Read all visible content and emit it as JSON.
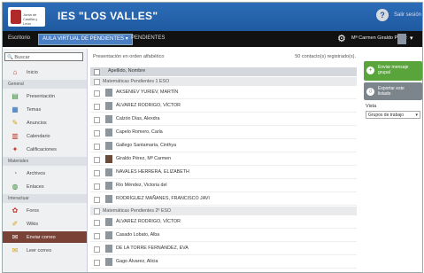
{
  "header": {
    "logo_text": [
      "Junta de",
      "Castilla y León"
    ],
    "title": "IES \"LOS VALLES\"",
    "help_label": "?",
    "login_label": "Salir sesión"
  },
  "navbar": {
    "breadcrumb_root": "Escritorio",
    "current_section": "AULA VIRTUAL DE PENDIENTES",
    "current_section_chevron": "▾",
    "sub_section": "PENDIENTES",
    "user_name": "Mª Carmen Giraldo Pérez",
    "icons": {
      "settings": "gear-icon",
      "user_menu": "chevron-down-icon"
    }
  },
  "sidebar": {
    "search_placeholder": "Buscar",
    "search_icon": "🔍",
    "items": [
      {
        "type": "item",
        "label": "Inicio",
        "icon": "⌂",
        "color": "#c0392b"
      },
      {
        "type": "header",
        "label": "General"
      },
      {
        "type": "item",
        "label": "Presentación",
        "icon": "▤",
        "color": "#3a8a3a"
      },
      {
        "type": "item",
        "label": "Temas",
        "icon": "▦",
        "color": "#2c6cb8"
      },
      {
        "type": "item",
        "label": "Anuncios",
        "icon": "✎",
        "color": "#d4a017"
      },
      {
        "type": "item",
        "label": "Calendario",
        "icon": "▥",
        "color": "#c0392b"
      },
      {
        "type": "item",
        "label": "Calificaciones",
        "icon": "✦",
        "color": "#c0392b"
      },
      {
        "type": "header",
        "label": "Materiales"
      },
      {
        "type": "item",
        "label": "Archivos",
        "icon": "◔",
        "color": "#999"
      },
      {
        "type": "item",
        "label": "Enlaces",
        "icon": "◍",
        "color": "#3a8a3a"
      },
      {
        "type": "header",
        "label": "Interactuar"
      },
      {
        "type": "item",
        "label": "Foros",
        "icon": "✿",
        "color": "#c0392b"
      },
      {
        "type": "item",
        "label": "Wikis",
        "icon": "✐",
        "color": "#d4a017"
      },
      {
        "type": "item",
        "label": "Enviar correo",
        "icon": "✉",
        "color": "#fff",
        "active": true
      },
      {
        "type": "item",
        "label": "Leer correo",
        "icon": "✉",
        "color": "#d4a017"
      }
    ]
  },
  "main": {
    "list_info": "Presentación en orden alfabético",
    "count_label": "50 contacto(s) registrado(s).",
    "col_header": "Apellido, Nombre",
    "rows": [
      {
        "type": "group",
        "name": "Matemáticas Pendientes 1 ESO"
      },
      {
        "type": "person",
        "name": "AKSENIEV YURIEV, MARTÍN"
      },
      {
        "type": "person",
        "name": "ÁLVAREZ RODRIGO, VÍCTOR"
      },
      {
        "type": "person",
        "name": "Calzón Días, Alexdra"
      },
      {
        "type": "person",
        "name": "Capelo Romero, Carla"
      },
      {
        "type": "person",
        "name": "Gallego Santamaría, Cinthya"
      },
      {
        "type": "person",
        "name": "Giraldo Pérez, Mª Carmen",
        "photo": true
      },
      {
        "type": "person",
        "name": "NAVALES HERRERA, ELIZABETH"
      },
      {
        "type": "person",
        "name": "Río Méndez, Victoria del"
      },
      {
        "type": "person",
        "name": "RODRÍGUEZ MAÑANES, FRANCISCO JAVI"
      },
      {
        "type": "group",
        "name": "Matemáticas Pendientes 2º ESO"
      },
      {
        "type": "person",
        "name": "ÁLVAREZ RODRIGO, VÍCTOR"
      },
      {
        "type": "person",
        "name": "Casado Lobato, Alba"
      },
      {
        "type": "person",
        "name": "DE LA TORRE FERNÁNDEZ, EVA"
      },
      {
        "type": "person",
        "name": "Gago Álvarez, Alicia"
      }
    ]
  },
  "right_panel": {
    "send_group_label": [
      "Enviar mensaje",
      "grupal"
    ],
    "send_group_icon": "+",
    "export_label": [
      "Exportar este",
      "listado"
    ],
    "export_icon": "⇩",
    "view_label": "Vista",
    "view_value": "Grupos de trabajo",
    "view_chevron": "▾"
  }
}
